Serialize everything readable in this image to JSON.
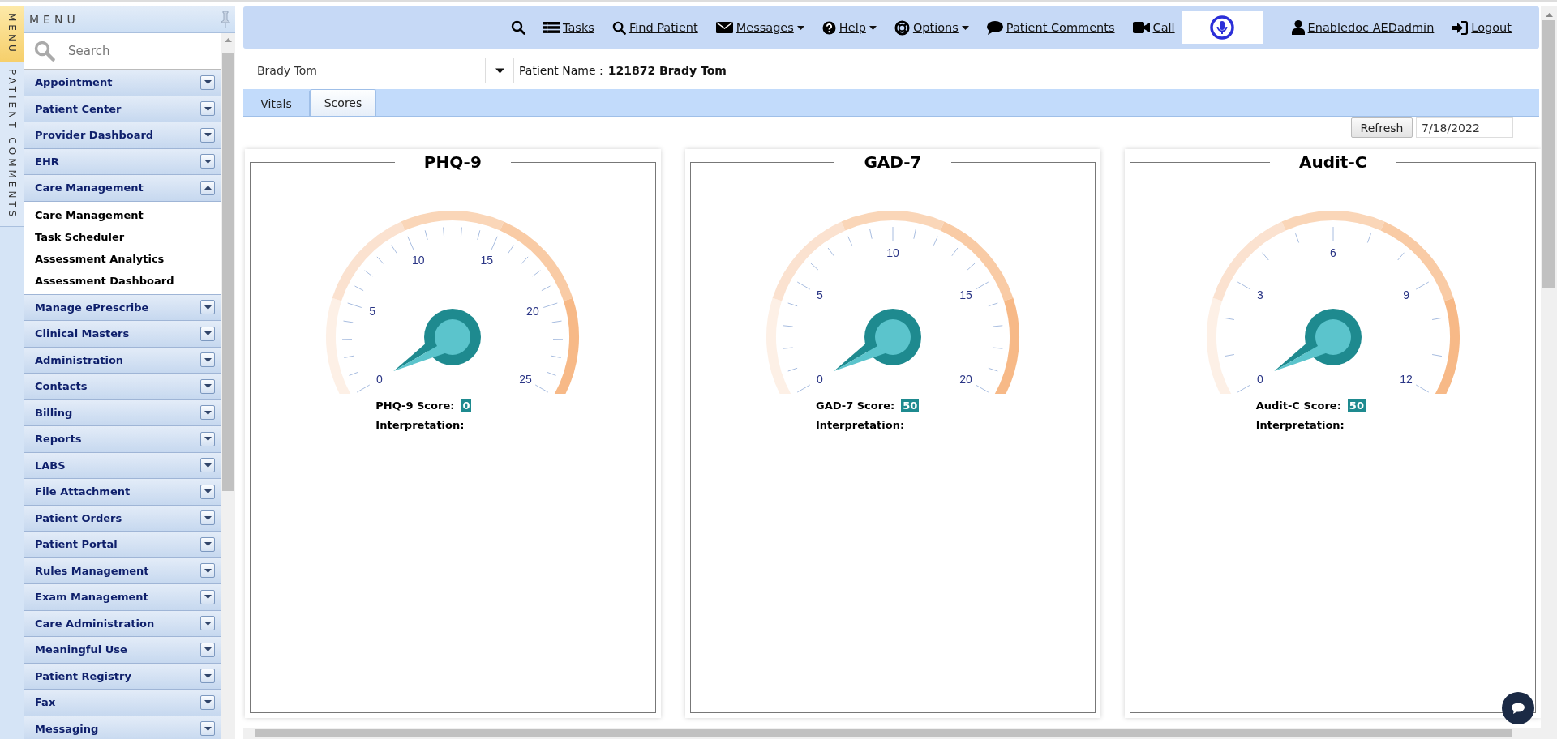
{
  "sidebar": {
    "tabs": [
      {
        "label": "MENU",
        "selected": true
      },
      {
        "label": "PATIENT COMMENTS",
        "selected": false
      }
    ],
    "title": "MENU",
    "search": {
      "placeholder": "Search"
    },
    "items": [
      {
        "label": "Appointment",
        "expanded": false
      },
      {
        "label": "Patient Center",
        "expanded": false
      },
      {
        "label": "Provider Dashboard",
        "expanded": false
      },
      {
        "label": "EHR",
        "expanded": false
      },
      {
        "label": "Care Management",
        "expanded": true,
        "children": [
          {
            "label": "Care Management"
          },
          {
            "label": "Task Scheduler"
          },
          {
            "label": "Assessment Analytics"
          },
          {
            "label": "Assessment Dashboard"
          }
        ]
      },
      {
        "label": "Manage ePrescribe",
        "expanded": false
      },
      {
        "label": "Clinical Masters",
        "expanded": false
      },
      {
        "label": "Administration",
        "expanded": false
      },
      {
        "label": "Contacts",
        "expanded": false
      },
      {
        "label": "Billing",
        "expanded": false
      },
      {
        "label": "Reports",
        "expanded": false
      },
      {
        "label": "LABS",
        "expanded": false
      },
      {
        "label": "File Attachment",
        "expanded": false
      },
      {
        "label": "Patient Orders",
        "expanded": false
      },
      {
        "label": "Patient Portal",
        "expanded": false
      },
      {
        "label": "Rules Management",
        "expanded": false
      },
      {
        "label": "Exam Management",
        "expanded": false
      },
      {
        "label": "Care Administration",
        "expanded": false
      },
      {
        "label": "Meaningful Use",
        "expanded": false
      },
      {
        "label": "Patient Registry",
        "expanded": false
      },
      {
        "label": "Fax",
        "expanded": false
      },
      {
        "label": "Messaging",
        "expanded": false
      }
    ]
  },
  "toolbar": {
    "items": [
      {
        "kind": "icon"
      },
      {
        "kind": "link",
        "label": "Tasks"
      },
      {
        "kind": "link",
        "label": "Find Patient"
      },
      {
        "kind": "menu",
        "label": "Messages"
      },
      {
        "kind": "menu",
        "label": "Help"
      },
      {
        "kind": "menu",
        "label": "Options"
      },
      {
        "kind": "link",
        "label": "Patient Comments"
      },
      {
        "kind": "link",
        "label": "Call"
      },
      {
        "kind": "mic"
      },
      {
        "kind": "link",
        "label": "Enabledoc AEDadmin"
      },
      {
        "kind": "link",
        "label": "Logout"
      }
    ]
  },
  "patient": {
    "select_value": "Brady Tom",
    "name_label": "Patient Name :",
    "name_value": "121872 Brady Tom"
  },
  "tabs": [
    {
      "label": "Vitals",
      "selected": false
    },
    {
      "label": "Scores",
      "selected": true
    }
  ],
  "refresh_button": "Refresh",
  "date": "7/18/2022",
  "gauges": [
    {
      "title": "PHQ-9",
      "ticks": [
        "0",
        "5",
        "10",
        "15",
        "20",
        "25"
      ],
      "score_label": "PHQ-9 Score:",
      "score": "0",
      "interpretation_label": "Interpretation:"
    },
    {
      "title": "GAD-7",
      "ticks": [
        "0",
        "5",
        "10",
        "15",
        "20"
      ],
      "score_label": "GAD-7 Score:",
      "score": "50",
      "interpretation_label": "Interpretation:"
    },
    {
      "title": "Audit-C",
      "ticks": [
        "0",
        "3",
        "6",
        "9",
        "12"
      ],
      "score_label": "Audit-C Score:",
      "score": "50",
      "interpretation_label": "Interpretation:"
    }
  ]
}
